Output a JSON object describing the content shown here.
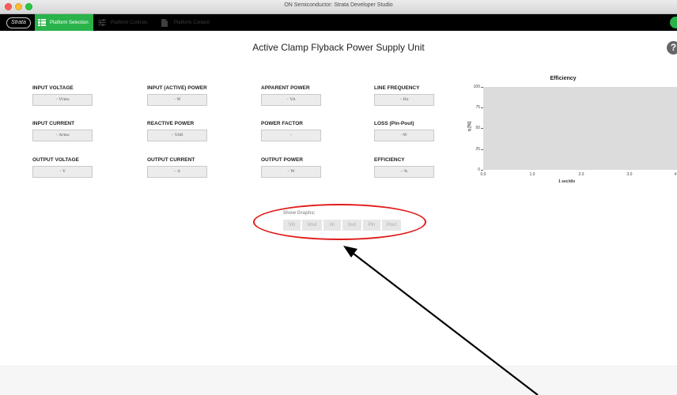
{
  "window": {
    "title": "ON Semiconductor: Strata Developer Studio"
  },
  "appbar": {
    "logo_text": "Strata",
    "tabs": [
      {
        "label": "Platform Selection",
        "active": true,
        "icon": "list-icon"
      },
      {
        "label": "Platform Controls",
        "active": false,
        "icon": "sliders-icon"
      },
      {
        "label": "Platform Content",
        "active": false,
        "icon": "document-icon"
      }
    ]
  },
  "page": {
    "title": "Active Clamp Flyback Power Supply Unit",
    "help_icon": "?"
  },
  "metrics": [
    {
      "label": "INPUT VOLTAGE",
      "value": "– Vrms"
    },
    {
      "label": "INPUT (ACTIVE) POWER",
      "value": "– W"
    },
    {
      "label": "APPARENT POWER",
      "value": "– VA"
    },
    {
      "label": "LINE FREQUENCY",
      "value": "– Hz"
    },
    {
      "label": "INPUT CURRENT",
      "value": "– Arms"
    },
    {
      "label": "REACTIVE POWER",
      "value": "– VAR"
    },
    {
      "label": "POWER FACTOR",
      "value": "–"
    },
    {
      "label": "LOSS (Pin-Pout)",
      "value": "–W"
    },
    {
      "label": "OUTPUT VOLTAGE",
      "value": "– V"
    },
    {
      "label": "OUTPUT CURRENT",
      "value": "– A"
    },
    {
      "label": "OUTPUT POWER",
      "value": "– W"
    },
    {
      "label": "EFFICIENCY",
      "value": "– %"
    }
  ],
  "chart_data": {
    "type": "line",
    "title": "Efficiency",
    "xlabel": "1 sec/div",
    "ylabel": "η [%]",
    "xlim": [
      0,
      4
    ],
    "ylim": [
      0,
      100
    ],
    "x_ticks": [
      "0.0",
      "1.0",
      "2.0",
      "3.0",
      "4"
    ],
    "y_ticks": [
      "0",
      "25",
      "50",
      "75",
      "100"
    ],
    "series": []
  },
  "show_graphs": {
    "label": "Show Graphs:",
    "buttons": [
      "Vin",
      "Vout",
      "Iin",
      "Iout",
      "Pin",
      "Pout"
    ]
  },
  "annotation": {
    "highlight_color": "#e01b1b",
    "arrow_color": "#000000"
  }
}
